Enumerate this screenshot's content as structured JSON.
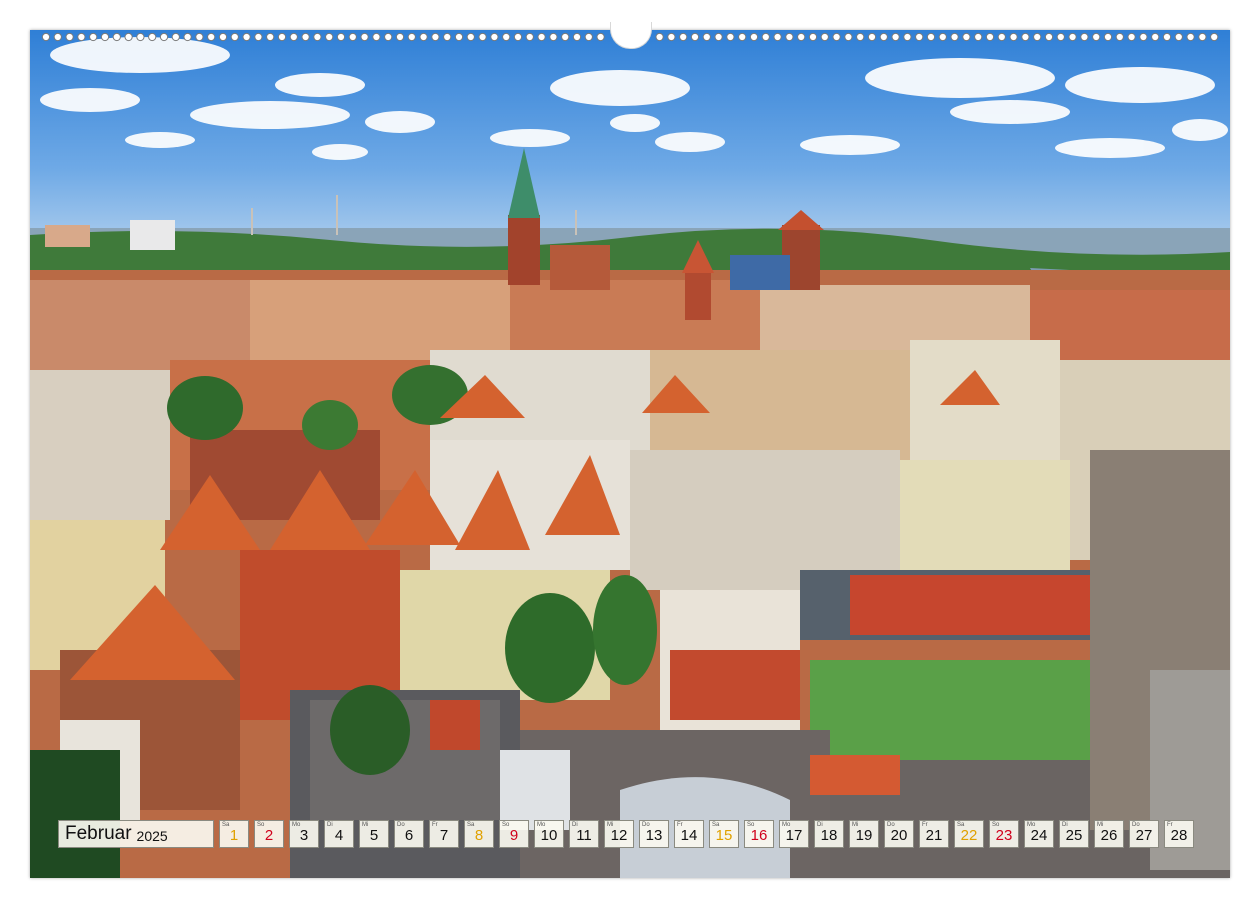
{
  "calendar": {
    "month": "Februar",
    "year": "2025",
    "days": [
      {
        "wd": "Sa",
        "n": "1",
        "type": "sat"
      },
      {
        "wd": "So",
        "n": "2",
        "type": "sun"
      },
      {
        "wd": "Mo",
        "n": "3",
        "type": "weekday"
      },
      {
        "wd": "Di",
        "n": "4",
        "type": "weekday"
      },
      {
        "wd": "Mi",
        "n": "5",
        "type": "weekday"
      },
      {
        "wd": "Do",
        "n": "6",
        "type": "weekday"
      },
      {
        "wd": "Fr",
        "n": "7",
        "type": "weekday"
      },
      {
        "wd": "Sa",
        "n": "8",
        "type": "sat"
      },
      {
        "wd": "So",
        "n": "9",
        "type": "sun"
      },
      {
        "wd": "Mo",
        "n": "10",
        "type": "weekday"
      },
      {
        "wd": "Di",
        "n": "11",
        "type": "weekday"
      },
      {
        "wd": "Mi",
        "n": "12",
        "type": "weekday"
      },
      {
        "wd": "Do",
        "n": "13",
        "type": "weekday"
      },
      {
        "wd": "Fr",
        "n": "14",
        "type": "weekday"
      },
      {
        "wd": "Sa",
        "n": "15",
        "type": "sat"
      },
      {
        "wd": "So",
        "n": "16",
        "type": "sun"
      },
      {
        "wd": "Mo",
        "n": "17",
        "type": "weekday"
      },
      {
        "wd": "Di",
        "n": "18",
        "type": "weekday"
      },
      {
        "wd": "Mi",
        "n": "19",
        "type": "weekday"
      },
      {
        "wd": "Do",
        "n": "20",
        "type": "weekday"
      },
      {
        "wd": "Fr",
        "n": "21",
        "type": "weekday"
      },
      {
        "wd": "Sa",
        "n": "22",
        "type": "sat"
      },
      {
        "wd": "So",
        "n": "23",
        "type": "sun"
      },
      {
        "wd": "Mo",
        "n": "24",
        "type": "weekday"
      },
      {
        "wd": "Di",
        "n": "25",
        "type": "weekday"
      },
      {
        "wd": "Mi",
        "n": "26",
        "type": "weekday"
      },
      {
        "wd": "Do",
        "n": "27",
        "type": "weekday"
      },
      {
        "wd": "Fr",
        "n": "28",
        "type": "weekday"
      }
    ]
  },
  "colors": {
    "saturday": "#e0a100",
    "sunday": "#d0001c",
    "cell_background": "#faf8f0"
  }
}
